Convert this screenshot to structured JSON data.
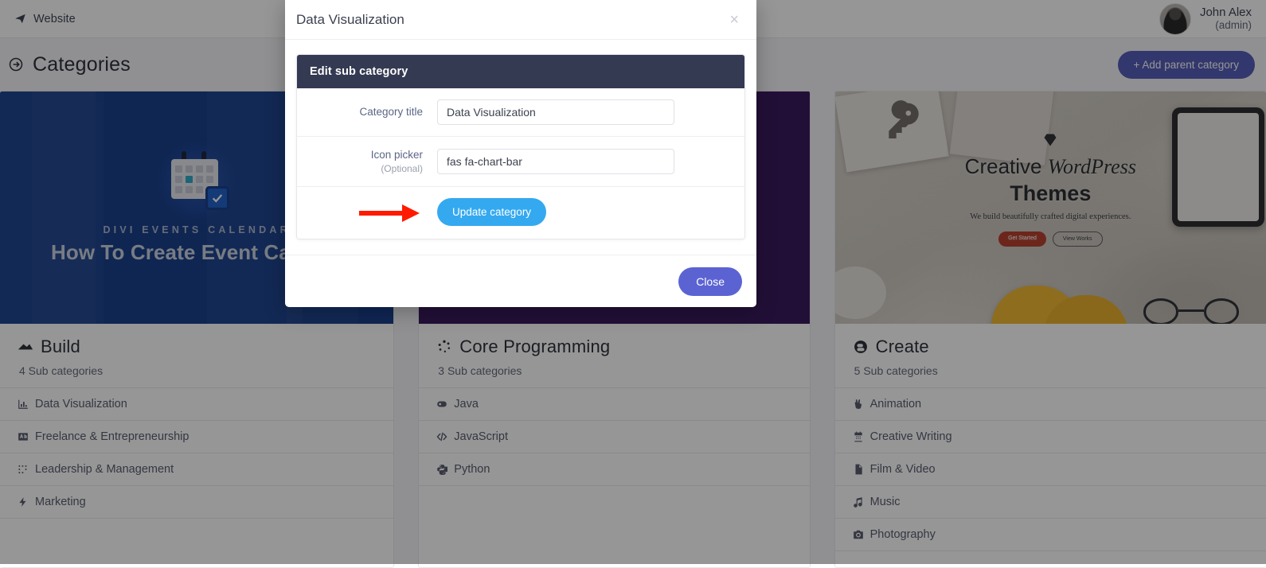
{
  "topbar": {
    "brand_label": "Website",
    "brand_icon": "paper-plane-icon",
    "user_name": "John Alex",
    "user_role": "(admin)"
  },
  "header": {
    "page_title": "Categories",
    "page_title_icon": "arrow-circle-right-icon",
    "add_parent_button": "+ Add parent category"
  },
  "cards": [
    {
      "title": "Build",
      "icon": "mountain-icon",
      "count_label": "4 Sub categories",
      "banner": {
        "kicker": "DIVI EVENTS CALENDAR",
        "headline": "How To Create Event Categor",
        "bg_color": "#0a3486"
      },
      "subcategories": [
        {
          "label": "Data Visualization",
          "icon": "chart-bar-icon"
        },
        {
          "label": "Freelance & Entrepreneurship",
          "icon": "ad-icon"
        },
        {
          "label": "Leadership & Management",
          "icon": "braille-icon"
        },
        {
          "label": "Marketing",
          "icon": "bolt-icon"
        }
      ]
    },
    {
      "title": "Core Programming",
      "icon": "spinner-icon",
      "count_label": "3 Sub categories",
      "banner": {
        "kicker": "",
        "headline": "",
        "bg_color": "#2c0a52"
      },
      "subcategories": [
        {
          "label": "Java",
          "icon": "mask-icon"
        },
        {
          "label": "JavaScript",
          "icon": "code-icon"
        },
        {
          "label": "Python",
          "icon": "python-icon"
        }
      ]
    },
    {
      "title": "Create",
      "icon": "blogger-icon",
      "count_label": "5 Sub categories",
      "banner": {
        "photo_title_1": "Creative ",
        "photo_title_1_em": "WordPress",
        "photo_title_2": "Themes",
        "photo_sub": "We build beautifully crafted digital experiences.",
        "photo_btn_primary": "Get Started",
        "photo_btn_secondary": "View Works"
      },
      "subcategories": [
        {
          "label": "Animation",
          "icon": "hand-peace-icon"
        },
        {
          "label": "Creative Writing",
          "icon": "calendar-icon"
        },
        {
          "label": "Film & Video",
          "icon": "file-icon"
        },
        {
          "label": "Music",
          "icon": "music-icon"
        },
        {
          "label": "Photography",
          "icon": "camera-icon"
        }
      ]
    }
  ],
  "modal": {
    "title": "Data Visualization",
    "close_x": "×",
    "panel_header": "Edit sub category",
    "fields": [
      {
        "label": "Category title",
        "optional": "",
        "value": "Data Visualization"
      },
      {
        "label": "Icon picker",
        "optional": "(Optional)",
        "value": "fas fa-chart-bar"
      }
    ],
    "update_button": "Update category",
    "close_button": "Close"
  },
  "colors": {
    "accent_blue": "#34a9f0",
    "indigo": "#5b63d3",
    "panel_dark": "#343a52",
    "annotation_red": "#ff1a00",
    "add_button": "#4a53b5"
  }
}
